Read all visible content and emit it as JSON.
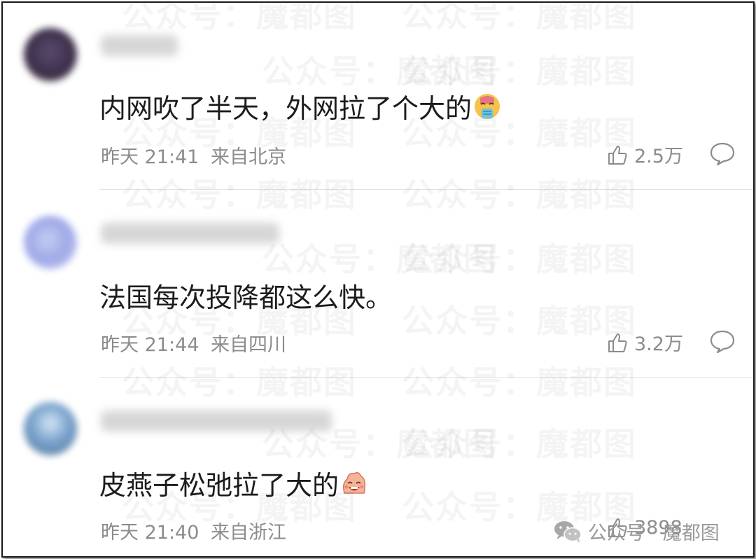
{
  "comments": [
    {
      "text": "内网吹了半天，外网拉了个大的",
      "emoji": "vomit-face-icon",
      "time": "昨天 21:41",
      "location": "来自北京",
      "likes": "2.5万"
    },
    {
      "text": "法国每次投降都这么快。",
      "emoji": "",
      "time": "昨天 21:44",
      "location": "来自四川",
      "likes": "3.2万"
    },
    {
      "text": "皮燕子松弛拉了大的",
      "emoji": "laughing-face-icon",
      "time": "昨天 21:40",
      "location": "来自浙江",
      "likes": "3898"
    }
  ],
  "watermark": {
    "text": "公众号：魔都图",
    "brand_label": "公众号 · 魔都图",
    "brand_icon": "wechat-icon"
  },
  "colors": {
    "text": "#1c1c1c",
    "meta": "#8c8c8c",
    "divider": "#e3e3e3"
  }
}
